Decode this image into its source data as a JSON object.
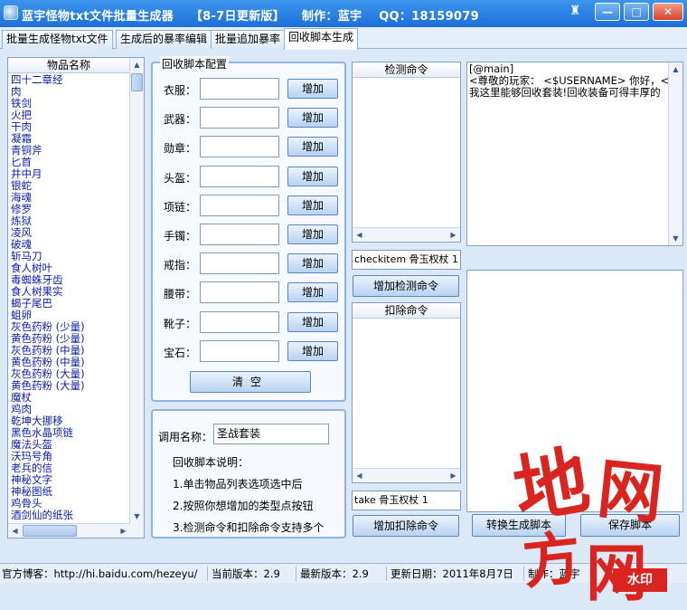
{
  "window": {
    "title_parts": [
      "蓝宇怪物txt文件批量生成器",
      "【8-7日更新版】",
      "制作：蓝宇",
      "QQ：18159079"
    ],
    "min_label": "—",
    "max_label": "□",
    "close_label": "✕",
    "skin_label": "♜"
  },
  "tabs": [
    {
      "label": "批量生成怪物txt文件"
    },
    {
      "label": "生成后的暴率编辑"
    },
    {
      "label": "批量追加暴率"
    },
    {
      "label": "回收脚本生成",
      "active": true
    }
  ],
  "item_list": {
    "header": "物品名称",
    "items": [
      "四十二章经",
      "肉",
      "铁剑",
      "火把",
      "干肉",
      "凝霜",
      "青铜斧",
      "匕首",
      "井中月",
      "银蛇",
      "海魂",
      "修罗",
      "炼狱",
      "凌风",
      "破魂",
      "斩马刀",
      "食人树叶",
      "毒蜘蛛牙齿",
      "食人树果实",
      "蝎子尾巴",
      "蛆卵",
      "灰色药粉 (少量)",
      "黄色药粉 (少量)",
      "灰色药粉 (中量)",
      "黄色药粉 (中量)",
      "灰色药粉 (大量)",
      "黄色药粉 (大量)",
      "魔杖",
      "鸡肉",
      "乾坤大挪移",
      "黑色水晶项链",
      "魔法头盔",
      "沃玛号角",
      "老兵的信",
      "神秘文字",
      "神秘图纸",
      "鸡骨头",
      "酒剑仙的纸张"
    ]
  },
  "config": {
    "title": "回收脚本配置",
    "rows": [
      {
        "label": "衣服：",
        "button": "增加"
      },
      {
        "label": "武器：",
        "button": "增加"
      },
      {
        "label": "勋章：",
        "button": "增加"
      },
      {
        "label": "头盔：",
        "button": "增加"
      },
      {
        "label": "项链：",
        "button": "增加"
      },
      {
        "label": "手镯：",
        "button": "增加"
      },
      {
        "label": "戒指：",
        "button": "增加"
      },
      {
        "label": "腰带：",
        "button": "增加"
      },
      {
        "label": "靴子：",
        "button": "增加"
      },
      {
        "label": "宝石：",
        "button": "增加"
      }
    ],
    "clear_button": "清空"
  },
  "help": {
    "name_label": "调用名称：",
    "name_value": "圣战套装",
    "desc_title": "回收脚本说明：",
    "lines": [
      "1.单击物品列表选项选中后",
      "2.按照你想增加的类型点按钮",
      "3.检测命令和扣除命令支持多个"
    ]
  },
  "detect": {
    "header": "检测命令",
    "input_value": "checkitem 骨玉权杖 1",
    "button": "增加检测命令"
  },
  "deduct": {
    "header": "扣除命令",
    "input_value": "take 骨玉权杖 1",
    "button": "增加扣除命令"
  },
  "script": {
    "line1": "[@main]",
    "line2": "<尊敬的玩家： <$USERNAME> 你好，<欢迎",
    "line3": "我这里能够回收套装!回收装备可得丰厚的"
  },
  "actions": {
    "generate": "转换生成脚本",
    "save": "保存脚本"
  },
  "status": {
    "blog": "官方博客：http://hi.baidu.com/hezeyu/",
    "current_version": "当前版本：2.9",
    "latest_version": "最新版本：2.9",
    "update_date": "更新日期：2011年8月7日",
    "author": "制作：蓝宇"
  },
  "watermark": {
    "chars": [
      "地",
      "网",
      "方",
      "网"
    ],
    "stamp": "水印"
  }
}
